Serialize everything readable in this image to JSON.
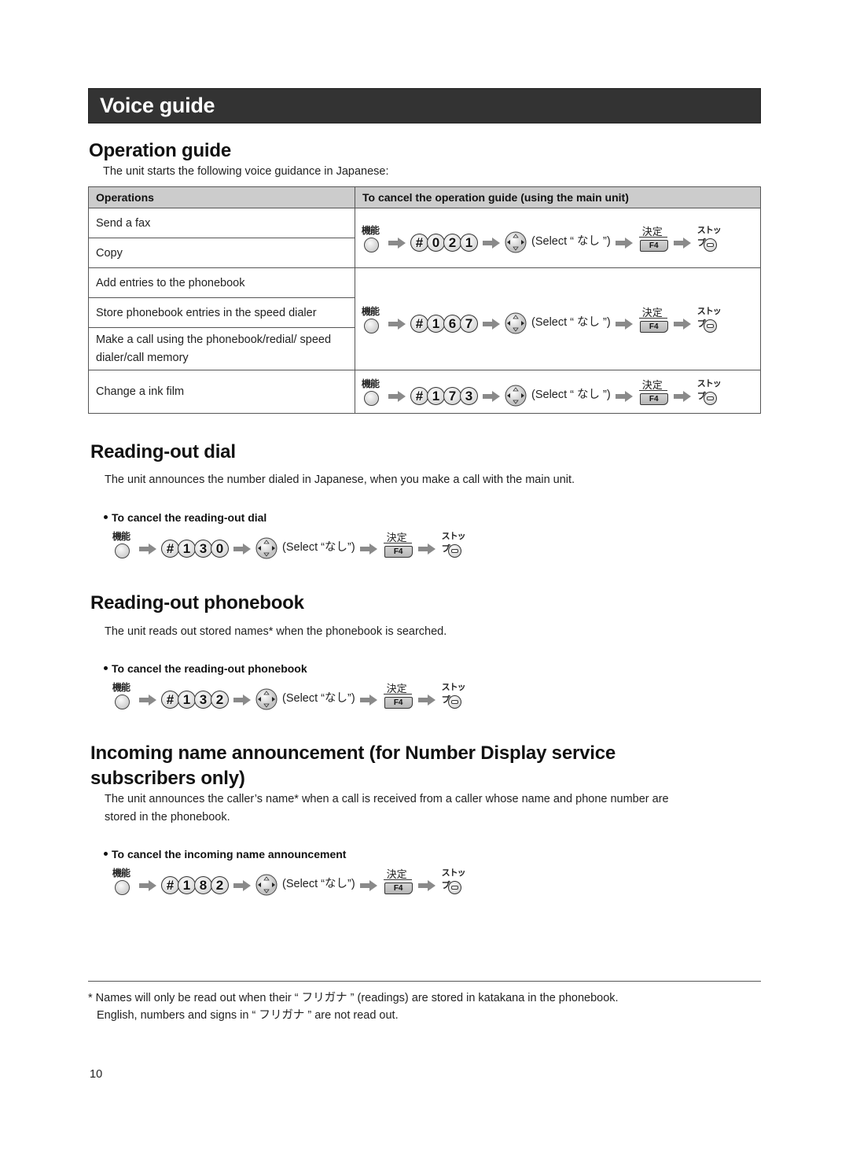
{
  "banner": {
    "title": "Voice guide"
  },
  "operation_guide": {
    "heading": "Operation guide",
    "intro": "The unit starts the following voice guidance in Japanese:",
    "table": {
      "headers": [
        "Operations",
        "To cancel the operation guide (using the main unit)"
      ],
      "groups": [
        {
          "operations": [
            "Send a fax",
            "Copy"
          ],
          "code": [
            "0",
            "2",
            "1"
          ]
        },
        {
          "operations": [
            "Add entries to the phonebook",
            "Store phonebook entries in the speed dialer",
            "Make a call using the phonebook/redial/ speed dialer/call memory"
          ],
          "code": [
            "1",
            "6",
            "7"
          ]
        },
        {
          "operations": [
            "Change a ink film"
          ],
          "code": [
            "1",
            "7",
            "3"
          ]
        }
      ]
    }
  },
  "sequence_labels": {
    "function_key": "機能",
    "hash": "#",
    "select_text_table": "(Select “ なし ”)",
    "select_text": "(Select “なし”)",
    "set_key_label": "決定",
    "set_key_button": "F4",
    "stop_key_label": "ストップ"
  },
  "reading_out_dial": {
    "heading": "Reading-out dial",
    "body": "The unit announces the number dialed in Japanese, when you make a call with the main unit.",
    "cancel_label": "To cancel the reading-out dial",
    "code": [
      "1",
      "3",
      "0"
    ]
  },
  "reading_out_phonebook": {
    "heading": "Reading-out phonebook",
    "body": "The unit reads out stored names* when the phonebook is searched.",
    "cancel_label": "To cancel the reading-out phonebook",
    "code": [
      "1",
      "3",
      "2"
    ]
  },
  "incoming_name": {
    "heading_line1": "Incoming name announcement (for Number Display service",
    "heading_line2": "subscribers only)",
    "body_line1": "The unit announces the caller’s name* when a call is received from a caller whose name and phone number are",
    "body_line2": "stored in the phonebook.",
    "cancel_label": "To cancel the incoming name announcement",
    "code": [
      "1",
      "8",
      "2"
    ]
  },
  "footnote": {
    "line1": "* Names will only be read out when their “ フリガナ ” (readings) are stored in katakana in the phonebook.",
    "line2": "English, numbers and signs in “ フリガナ ” are not read out."
  },
  "page_number": "10",
  "colors": {
    "banner_bg": "#333333",
    "table_header_bg": "#cccccc",
    "arrow": "#8a8a8a"
  }
}
